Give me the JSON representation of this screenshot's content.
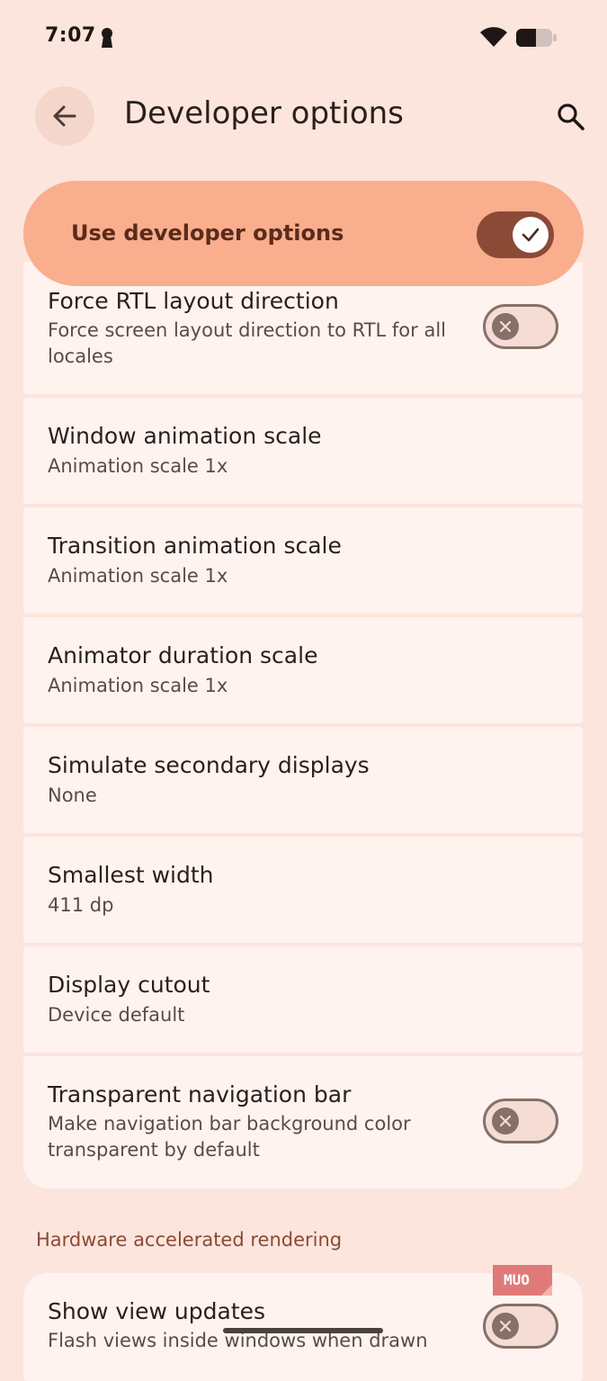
{
  "status_bar": {
    "time": "7:07",
    "icons": [
      "keyhole-icon",
      "wifi-icon",
      "battery-icon"
    ]
  },
  "app_bar": {
    "title": "Developer options",
    "back_icon": "arrow-back-icon",
    "search_icon": "search-icon"
  },
  "master_toggle": {
    "label": "Use developer options",
    "enabled": true
  },
  "settings": [
    {
      "title": "Force RTL layout direction",
      "summary": "Force screen layout direction to RTL for all locales",
      "switch": false
    },
    {
      "title": "Window animation scale",
      "summary": "Animation scale 1x"
    },
    {
      "title": "Transition animation scale",
      "summary": "Animation scale 1x"
    },
    {
      "title": "Animator duration scale",
      "summary": "Animation scale 1x"
    },
    {
      "title": "Simulate secondary displays",
      "summary": "None"
    },
    {
      "title": "Smallest width",
      "summary": "411 dp"
    },
    {
      "title": "Display cutout",
      "summary": "Device default"
    },
    {
      "title": "Transparent navigation bar",
      "summary": "Make navigation bar background color transparent by default",
      "switch": false
    }
  ],
  "section": {
    "title": "Hardware accelerated rendering"
  },
  "hardware_settings": [
    {
      "title": "Show view updates",
      "summary": "Flash views inside windows when drawn",
      "switch": false
    }
  ],
  "watermark": {
    "text": "MUO"
  },
  "colors": {
    "background": "#FCE5DC",
    "card": "#FFF3EF",
    "master_toggle_bg": "#F9AE8E",
    "accent": "#8A4A36",
    "switch_off_thumb": "#86706A"
  }
}
